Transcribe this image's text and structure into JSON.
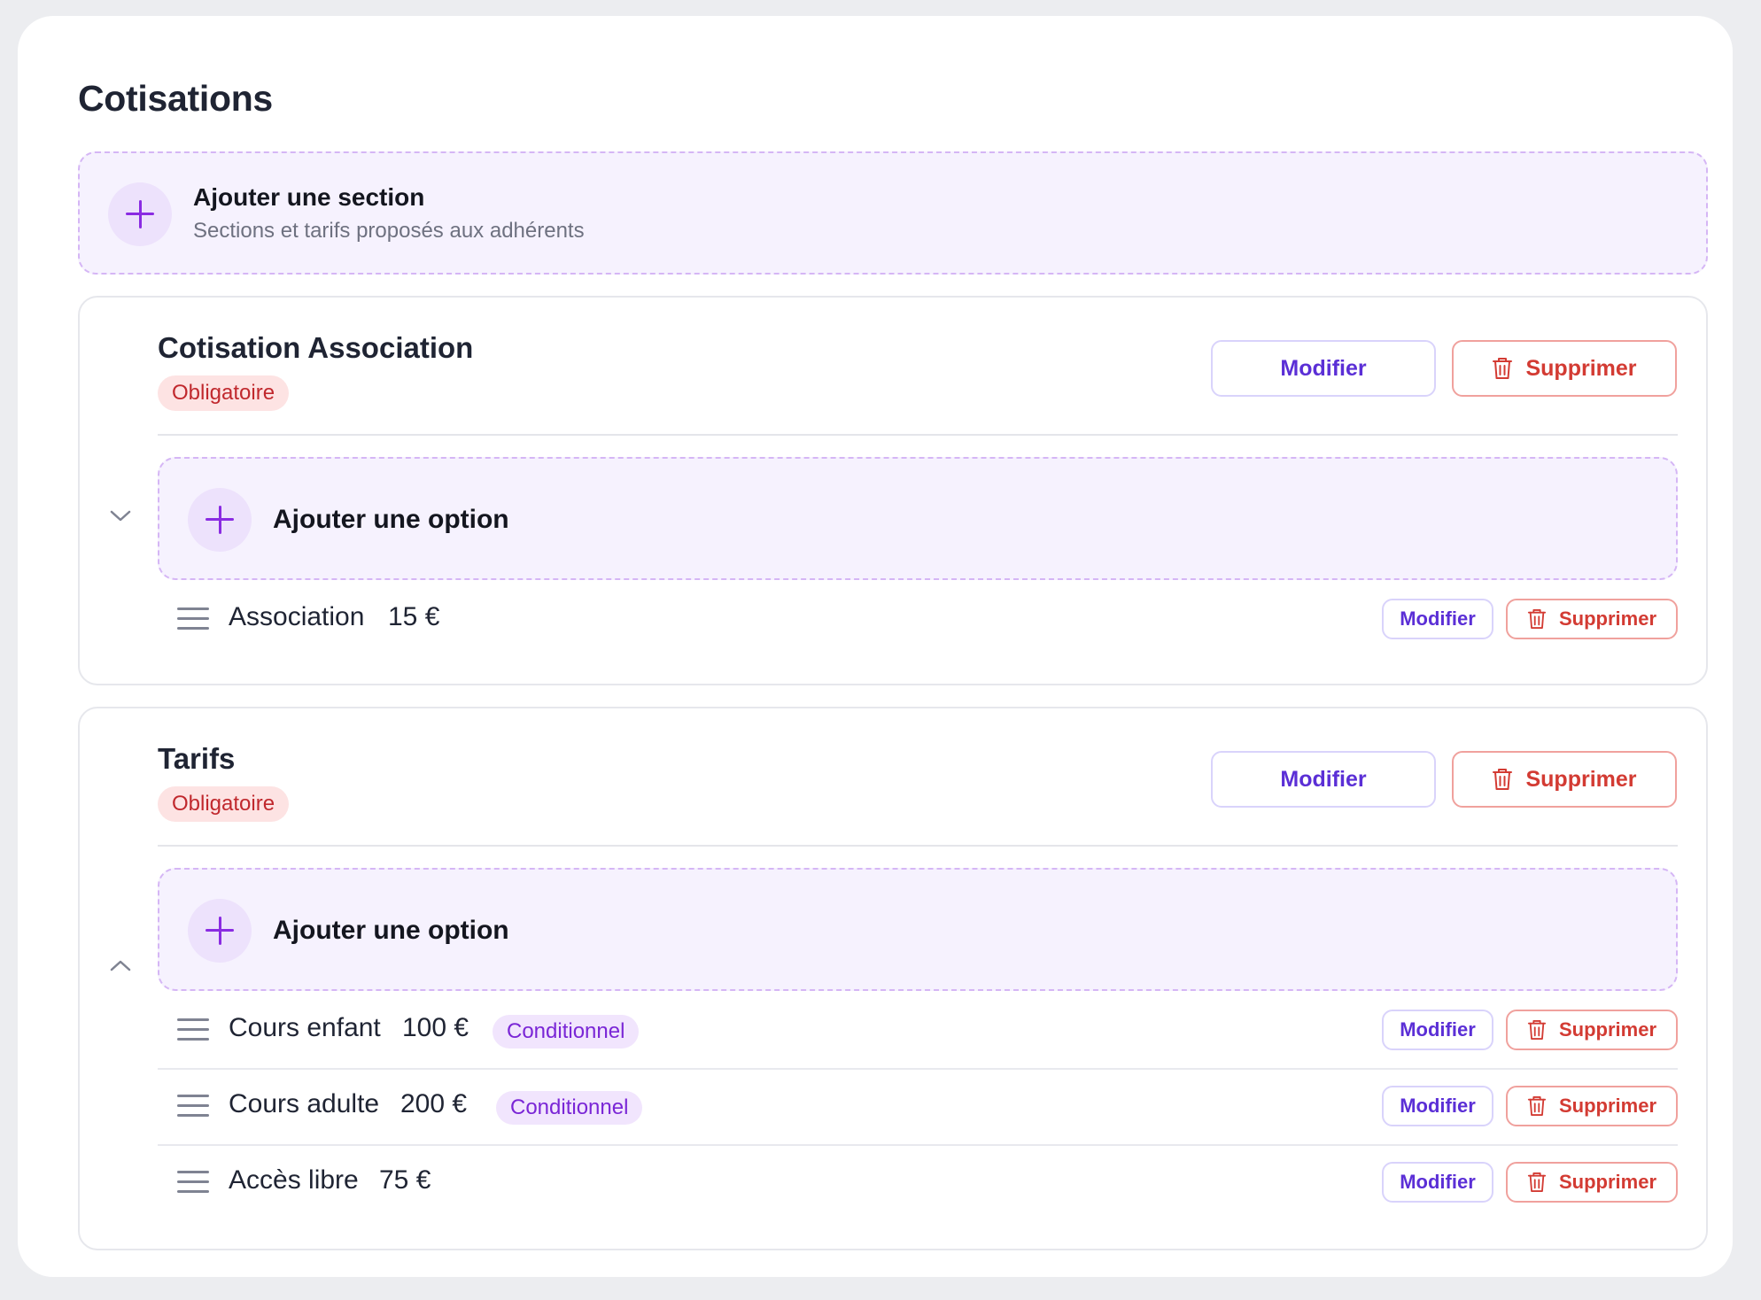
{
  "page": {
    "title": "Cotisations"
  },
  "add_section": {
    "title": "Ajouter une section",
    "subtitle": "Sections et tarifs proposés aux adhérents"
  },
  "buttons": {
    "edit": "Modifier",
    "delete": "Supprimer",
    "add_option": "Ajouter une option"
  },
  "colors": {
    "accent_purple": "#8a2be2",
    "edit_text": "#5b2fd6",
    "delete_text": "#d33b33",
    "mandatory_badge_bg": "#fde3e3",
    "conditional_badge_bg": "#f1e5fd"
  },
  "sections": [
    {
      "title": "Cotisation Association",
      "badge": "Obligatoire",
      "expanded_icon": "chevron-down-icon",
      "options": [
        {
          "name": "Association",
          "price": "15 €",
          "badge": ""
        }
      ]
    },
    {
      "title": "Tarifs",
      "badge": "Obligatoire",
      "expanded_icon": "chevron-up-icon",
      "options": [
        {
          "name": "Cours enfant",
          "price": "100 €",
          "badge": "Conditionnel"
        },
        {
          "name": "Cours adulte",
          "price": "200 €",
          "badge": "Conditionnel"
        },
        {
          "name": "Accès libre",
          "price": "75 €",
          "badge": ""
        }
      ]
    }
  ]
}
